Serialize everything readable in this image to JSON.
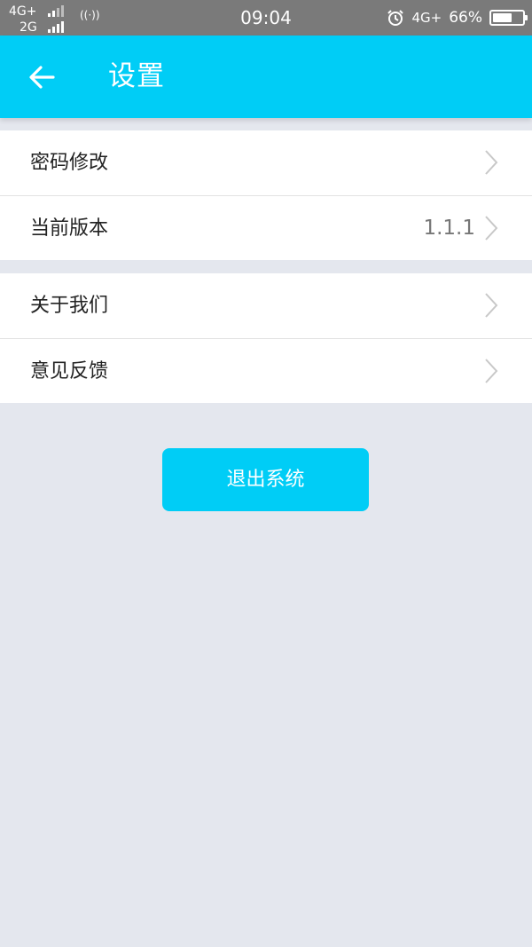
{
  "status_bar": {
    "network_1": "4G+",
    "network_2": "2G",
    "hotspot_icon": "hotspot-icon",
    "time": "09:04",
    "alarm_icon": "alarm-icon",
    "network_right": "4G+",
    "battery_percent": "66%",
    "battery_level": 0.66
  },
  "app_bar": {
    "back_icon": "arrow-left-icon",
    "title": "设置",
    "background": "#00cdf6"
  },
  "settings": {
    "group_1": [
      {
        "label": "密码修改",
        "value": ""
      },
      {
        "label": "当前版本",
        "value": "1.1.1"
      }
    ],
    "group_2": [
      {
        "label": "关于我们",
        "value": ""
      },
      {
        "label": "意见反馈",
        "value": ""
      }
    ]
  },
  "logout_button": {
    "label": "退出系统"
  },
  "colors": {
    "accent": "#00cdf6",
    "page_background": "#e4e7ee",
    "status_bar": "#7a7a7a"
  }
}
